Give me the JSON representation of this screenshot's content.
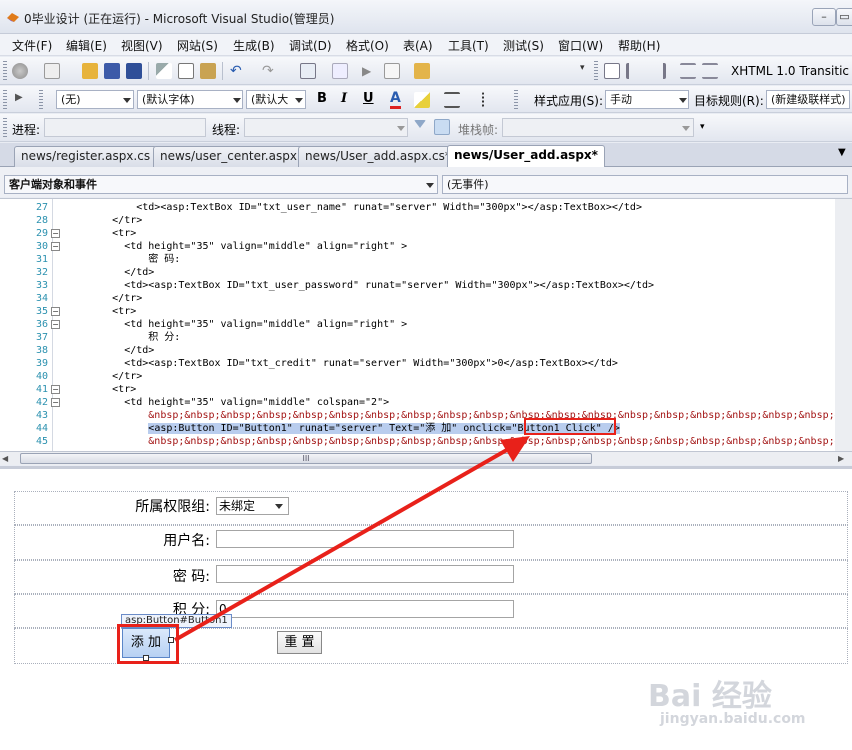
{
  "window": {
    "title": "0毕业设计 (正在运行) - Microsoft Visual Studio(管理员)",
    "minimize_glyph": "–",
    "maximize_glyph": "▭"
  },
  "menu": [
    "文件(F)",
    "编辑(E)",
    "视图(V)",
    "网站(S)",
    "生成(B)",
    "调试(D)",
    "格式(O)",
    "表(A)",
    "工具(T)",
    "测试(S)",
    "窗口(W)",
    "帮助(H)"
  ],
  "toolbar1": {
    "doctype": "XHTML 1.0 Transitic"
  },
  "toolbar2": {
    "block_format": "(无)",
    "font": "(默认字体)",
    "size": "(默认大",
    "bold": "B",
    "italic": "I",
    "underline": "U",
    "style_app_label": "样式应用(S):",
    "style_app_value": "手动",
    "target_rule_label": "目标规则(R):",
    "target_rule_value": "(新建级联样式)"
  },
  "toolbar3": {
    "process_label": "进程:",
    "thread_label": "线程:",
    "stack_label": "堆栈帧:"
  },
  "tabs": [
    "news/register.aspx.cs",
    "news/user_center.aspx",
    "news/User_add.aspx.cs*",
    "news/User_add.aspx*"
  ],
  "active_tab_index": 3,
  "objects_bar": {
    "left": "客户端对象和事件",
    "right": "(无事件)"
  },
  "code_lines": [
    {
      "n": "27",
      "fold": "",
      "text": "            <td><asp:TextBox ID=\"txt_user_name\" runat=\"server\" Width=\"300px\"></asp:TextBox></td>"
    },
    {
      "n": "28",
      "fold": "",
      "text": "        </tr>"
    },
    {
      "n": "29",
      "fold": "−",
      "text": "        <tr>"
    },
    {
      "n": "30",
      "fold": "−",
      "text": "          <td height=\"35\" valign=\"middle\" align=\"right\" >"
    },
    {
      "n": "31",
      "fold": "",
      "text": "              密 码:"
    },
    {
      "n": "32",
      "fold": "",
      "text": "          </td>"
    },
    {
      "n": "33",
      "fold": "",
      "text": "          <td><asp:TextBox ID=\"txt_user_password\" runat=\"server\" Width=\"300px\"></asp:TextBox></td>"
    },
    {
      "n": "34",
      "fold": "",
      "text": "        </tr>"
    },
    {
      "n": "35",
      "fold": "−",
      "text": "        <tr>"
    },
    {
      "n": "36",
      "fold": "−",
      "text": "          <td height=\"35\" valign=\"middle\" align=\"right\" >"
    },
    {
      "n": "37",
      "fold": "",
      "text": "              积 分:"
    },
    {
      "n": "38",
      "fold": "",
      "text": "          </td>"
    },
    {
      "n": "39",
      "fold": "",
      "text": "          <td><asp:TextBox ID=\"txt_credit\" runat=\"server\" Width=\"300px\">0</asp:TextBox></td>"
    },
    {
      "n": "40",
      "fold": "",
      "text": "        </tr>"
    },
    {
      "n": "41",
      "fold": "−",
      "text": "        <tr>"
    },
    {
      "n": "42",
      "fold": "−",
      "text": "          <td height=\"35\" valign=\"middle\" colspan=\"2\">"
    },
    {
      "n": "43",
      "fold": "",
      "text": "              &nbsp;&nbsp;&nbsp;&nbsp;&nbsp;&nbsp;&nbsp;&nbsp;&nbsp;&nbsp;&nbsp;&nbsp;&nbsp;&nbsp;&nbsp;&nbsp;&nbsp;&nbsp;&nbsp;&nbsp;&nbsp;&nbsp;&n"
    },
    {
      "n": "44",
      "fold": "",
      "text": "              <asp:Button ID=\"Button1\" runat=\"server\" Text=\"添 加\" onclick=\"Button1_Click\" />"
    },
    {
      "n": "45",
      "fold": "",
      "text": "              &nbsp;&nbsp;&nbsp;&nbsp;&nbsp;&nbsp;&nbsp;&nbsp;&nbsp;&nbsp;&nbsp;&nbsp;&nbsp;&nbsp;&nbsp;&nbsp;&nbsp;&nbsp;&nbsp;&nbsp;&nbsp;&nbsp;&n"
    }
  ],
  "highlight_text": "Button1_Click",
  "hscroll_thumb_glyph": "III",
  "design": {
    "group_label": "所属权限组:",
    "group_value": "未绑定",
    "username_label": "用户名:",
    "password_label": "密 码:",
    "credit_label": "积 分:",
    "credit_value": "0",
    "button_tag": "asp:Button#Button1",
    "add_button": "添 加",
    "reset_button": "重 置"
  },
  "watermark": {
    "brand": "Bai 经验",
    "url": "jingyan.baidu.com"
  },
  "colors": {
    "annotation": "#e8211a",
    "selection": "#b9cdee",
    "keyword": "#a31515",
    "attr": "#ff0000",
    "value": "#0000ff"
  }
}
